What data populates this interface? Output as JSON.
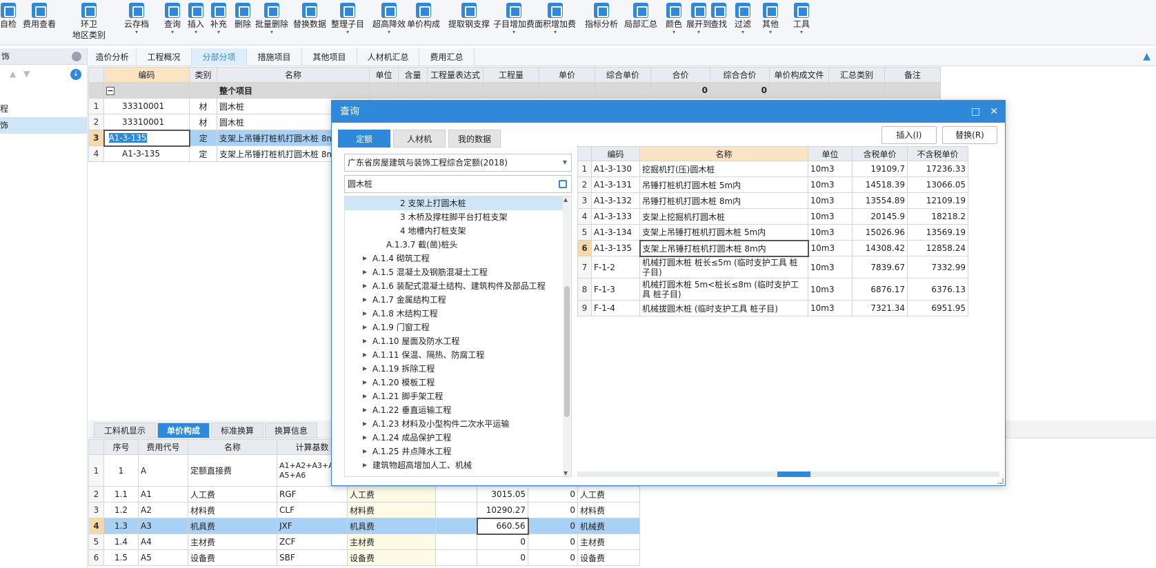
{
  "ribbon": {
    "items": [
      {
        "label": "自检",
        "icon": "check-icon"
      },
      {
        "label": "费用查看",
        "icon": "view-fee-icon"
      },
      {
        "label": "环卫\n地区类别",
        "icon": "region-icon"
      },
      {
        "label": "云存档",
        "icon": "cloud-icon",
        "dropdown": true
      },
      {
        "label": "查询",
        "icon": "query-icon",
        "dropdown": true
      },
      {
        "label": "插入",
        "icon": "insert-icon",
        "dropdown": true
      },
      {
        "label": "补充",
        "icon": "supplement-icon",
        "dropdown": true
      },
      {
        "label": "删除",
        "icon": "delete-icon"
      },
      {
        "label": "批量删除",
        "icon": "batch-delete-icon",
        "dropdown": true
      },
      {
        "label": "替换数据",
        "icon": "replace-icon"
      },
      {
        "label": "整理子目",
        "icon": "organize-icon",
        "dropdown": true
      },
      {
        "label": "超高降效",
        "icon": "height-icon",
        "dropdown": true
      },
      {
        "label": "单价构成",
        "icon": "price-icon"
      },
      {
        "label": "提取钢支撑",
        "icon": "steel-icon"
      },
      {
        "label": "子目增加费",
        "icon": "add-fee-icon",
        "dropdown": true
      },
      {
        "label": "面积增加费",
        "icon": "area-icon",
        "dropdown": true
      },
      {
        "label": "指标分析",
        "icon": "analysis-icon"
      },
      {
        "label": "局部汇总",
        "icon": "summary-icon"
      },
      {
        "label": "颜色",
        "icon": "color-icon",
        "dropdown": true
      },
      {
        "label": "展开到",
        "icon": "expand-icon",
        "dropdown": true
      },
      {
        "label": "查找",
        "icon": "find-icon"
      },
      {
        "label": "过滤",
        "icon": "filter-icon",
        "dropdown": true
      },
      {
        "label": "其他",
        "icon": "other-icon",
        "dropdown": true
      },
      {
        "label": "工具",
        "icon": "tool-icon",
        "dropdown": true
      }
    ]
  },
  "left_panel": {
    "header": "饰",
    "items": [
      "",
      "程",
      "饰"
    ]
  },
  "tabs": [
    "造价分析",
    "工程概况",
    "分部分项",
    "措施项目",
    "其他项目",
    "人材机汇总",
    "费用汇总"
  ],
  "active_tab": "分部分项",
  "main_grid": {
    "headers": [
      "",
      "编码",
      "类别",
      "名称",
      "单位",
      "含量",
      "工程量表达式",
      "工程量",
      "单价",
      "综合单价",
      "合价",
      "综合合价",
      "单价构成文件",
      "汇总类别",
      "备注"
    ],
    "summary_row": {
      "toggle": "−",
      "name": "整个项目",
      "hejia": "0",
      "zonghe_hejia": "0"
    },
    "rows": [
      {
        "rn": "1",
        "code": "33310001",
        "type": "材",
        "name": "圆木桩"
      },
      {
        "rn": "2",
        "code": "33310001",
        "type": "材",
        "name": "圆木桩"
      },
      {
        "rn": "3",
        "code": "A1-3-135",
        "type": "定",
        "name": "支架上吊锤打桩机打圆木桩 8m"
      },
      {
        "rn": "4",
        "code": "A1-3-135",
        "type": "定",
        "name": "支架上吊锤打桩机打圆木桩 8m"
      }
    ]
  },
  "bottom": {
    "tabs": [
      "工料机显示",
      "单价构成",
      "标准换算",
      "换算信息"
    ],
    "active_tab": "单价构成",
    "headers": [
      "",
      "序号",
      "费用代号",
      "名称",
      "计算基数"
    ],
    "rows": [
      {
        "rn": "1",
        "seq": "1",
        "code": "A",
        "name": "定额直接费",
        "base": "A1+A2+A3+A4+A5+A6",
        "base_name": "",
        "v1": "",
        "v2": "",
        "cat": ""
      },
      {
        "rn": "2",
        "seq": "1.1",
        "code": "A1",
        "name": "人工费",
        "base": "RGF",
        "base_name": "人工费",
        "v1": "3015.05",
        "v2": "0",
        "cat": "人工费"
      },
      {
        "rn": "3",
        "seq": "1.2",
        "code": "A2",
        "name": "材料费",
        "base": "CLF",
        "base_name": "材料费",
        "v1": "10290.27",
        "v2": "0",
        "cat": "材料费"
      },
      {
        "rn": "4",
        "seq": "1.3",
        "code": "A3",
        "name": "机具费",
        "base": "JXF",
        "base_name": "机具费",
        "v1": "660.56",
        "v2": "0",
        "cat": "机械费"
      },
      {
        "rn": "5",
        "seq": "1.4",
        "code": "A4",
        "name": "主材费",
        "base": "ZCF",
        "base_name": "主材费",
        "v1": "0",
        "v2": "0",
        "cat": "主材费"
      },
      {
        "rn": "6",
        "seq": "1.5",
        "code": "A5",
        "name": "设备费",
        "base": "SBF",
        "base_name": "设备费",
        "v1": "0",
        "v2": "0",
        "cat": "设备费"
      }
    ]
  },
  "dialog": {
    "title": "查询",
    "tabs": [
      "定额",
      "人材机",
      "我的数据"
    ],
    "active_tab": "定额",
    "insert_button": "插入(I)",
    "replace_button": "替换(R)",
    "quota_select": "广东省房屋建筑与装饰工程综合定额(2018)",
    "search_value": "圆木桩",
    "tree": [
      {
        "label": "2 支架上打圆木桩",
        "level": 3,
        "selected": true,
        "arrow": false
      },
      {
        "label": "3 木桥及撑柱脚平台打桩支架",
        "level": 3,
        "arrow": false
      },
      {
        "label": "4 地槽内打桩支架",
        "level": 3,
        "arrow": false
      },
      {
        "label": "A.1.3.7 截(凿)桩头",
        "level": 2,
        "arrow": false
      },
      {
        "label": "A.1.4 砌筑工程",
        "level": 1,
        "arrow": true
      },
      {
        "label": "A.1.5 混凝土及钢筋混凝土工程",
        "level": 1,
        "arrow": true
      },
      {
        "label": "A.1.6 装配式混凝土结构、建筑构件及部品工程",
        "level": 1,
        "arrow": true
      },
      {
        "label": "A.1.7 金属结构工程",
        "level": 1,
        "arrow": true
      },
      {
        "label": "A.1.8 木结构工程",
        "level": 1,
        "arrow": true
      },
      {
        "label": "A.1.9 门窗工程",
        "level": 1,
        "arrow": true
      },
      {
        "label": "A.1.10 屋面及防水工程",
        "level": 1,
        "arrow": true
      },
      {
        "label": "A.1.11 保温、隔热、防腐工程",
        "level": 1,
        "arrow": true
      },
      {
        "label": "A.1.19 拆除工程",
        "level": 1,
        "arrow": true
      },
      {
        "label": "A.1.20 模板工程",
        "level": 1,
        "arrow": true
      },
      {
        "label": "A.1.21 脚手架工程",
        "level": 1,
        "arrow": true
      },
      {
        "label": "A.1.22 垂直运输工程",
        "level": 1,
        "arrow": true
      },
      {
        "label": "A.1.23 材料及小型构件二次水平运输",
        "level": 1,
        "arrow": true
      },
      {
        "label": "A.1.24 成品保护工程",
        "level": 1,
        "arrow": true
      },
      {
        "label": "A.1.25 井点降水工程",
        "level": 1,
        "arrow": true
      },
      {
        "label": "建筑物超高增加人工、机械",
        "level": 0,
        "arrow": true
      }
    ],
    "results_headers": [
      "",
      "编码",
      "名称",
      "单位",
      "含税单价",
      "不含税单价"
    ],
    "results": [
      {
        "rn": "1",
        "code": "A1-3-130",
        "name": "挖掘机打(压)圆木桩",
        "unit": "10m3",
        "tax": "19109.7",
        "notax": "17236.33"
      },
      {
        "rn": "2",
        "code": "A1-3-131",
        "name": "吊锤打桩机打圆木桩 5m内",
        "unit": "10m3",
        "tax": "14518.39",
        "notax": "13066.05"
      },
      {
        "rn": "3",
        "code": "A1-3-132",
        "name": "吊锤打桩机打圆木桩 8m内",
        "unit": "10m3",
        "tax": "13554.89",
        "notax": "12109.19"
      },
      {
        "rn": "4",
        "code": "A1-3-133",
        "name": "支架上挖掘机打圆木桩",
        "unit": "10m3",
        "tax": "20145.9",
        "notax": "18218.2"
      },
      {
        "rn": "5",
        "code": "A1-3-134",
        "name": "支架上吊锤打桩机打圆木桩 5m内",
        "unit": "10m3",
        "tax": "15026.96",
        "notax": "13569.19"
      },
      {
        "rn": "6",
        "code": "A1-3-135",
        "name": "支架上吊锤打桩机打圆木桩 8m内",
        "unit": "10m3",
        "tax": "14308.42",
        "notax": "12858.24"
      },
      {
        "rn": "7",
        "code": "F-1-2",
        "name": "机械打圆木桩 桩长≤5m (临时支护工具 桩子目)",
        "unit": "10m3",
        "tax": "7839.67",
        "notax": "7332.99"
      },
      {
        "rn": "8",
        "code": "F-1-3",
        "name": "机械打圆木桩 5m<桩长≤8m (临时支护工具 桩子目)",
        "unit": "10m3",
        "tax": "6876.17",
        "notax": "6376.13"
      },
      {
        "rn": "9",
        "code": "F-1-4",
        "name": "机械拔圆木桩 (临时支护工具 桩子目)",
        "unit": "10m3",
        "tax": "7321.34",
        "notax": "6951.95"
      }
    ],
    "current_result": "6"
  },
  "colors": {
    "accent": "#2f89d8",
    "selected_row": "#a8d1f5",
    "header_highlight": "#fbe4c3"
  }
}
